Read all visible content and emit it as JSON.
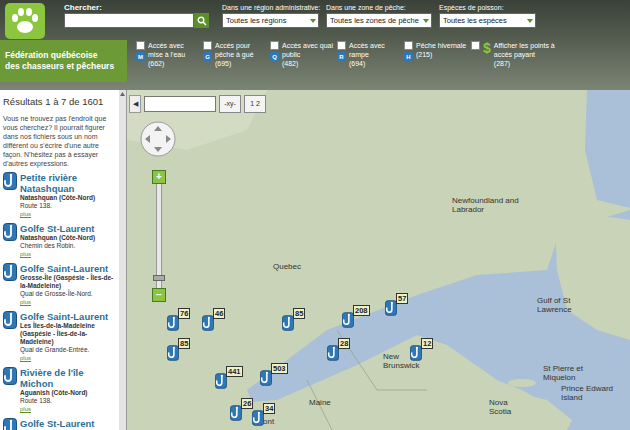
{
  "logo": {
    "title_lines": [
      "Fédération québécoise",
      "des chasseurs et pêcheurs"
    ]
  },
  "search": {
    "label": "Chercher:",
    "value": ""
  },
  "filters": [
    {
      "label": "Dans une région administrative:",
      "value": "Toutes les régions"
    },
    {
      "label": "Dans une zone de pêche:",
      "value": "Toutes les zones de pêche"
    },
    {
      "label": "Espèces de poisson:",
      "value": "Toutes les espèces"
    }
  ],
  "access_filters": [
    {
      "badge": "M",
      "label": "Accès avec mise à l'eau",
      "count": "(662)",
      "checked": false
    },
    {
      "badge": "G",
      "label": "Accès pour pêche à gué",
      "count": "(695)",
      "checked": false
    },
    {
      "badge": "Q",
      "label": "Accès avec quai public",
      "count": "(482)",
      "checked": false
    },
    {
      "badge": "R",
      "label": "Accès avec rampe",
      "count": "(694)",
      "checked": false
    },
    {
      "badge": "H",
      "label": "Pêche hivernale",
      "count": "(215)",
      "checked": false
    }
  ],
  "paid_filter": {
    "badge": "$",
    "label": "Afficher les points à accès payant",
    "count": "(287)",
    "checked": false
  },
  "results": {
    "summary": "Résultats 1 à 7 de 1601",
    "hint": "Vous ne trouvez pas l'endroit que vous cherchez? Il pourrait figurer dans nos fichiers sous un nom différent ou s'écrire d'une autre façon. N'hésitez pas à essayer d'autres expressions.",
    "items": [
      {
        "title": "Petite rivière Natashquan",
        "location": "Natashquan (Côte-Nord)",
        "road": "Route 138.",
        "link": "plus"
      },
      {
        "title": "Golfe St-Laurent",
        "location": "Natashquan (Côte-Nord)",
        "road": "Chemin des Robin.",
        "link": "plus"
      },
      {
        "title": "Golfe Saint-Laurent",
        "location": "Grosse-Île (Gaspésie - Îles-de-la-Madeleine)",
        "road": "Quai de Grosse-Île-Nord.",
        "link": "plus"
      },
      {
        "title": "Golfe Saint-Laurent",
        "location": "Les Îles-de-la-Madeleine (Gaspésie - Îles-de-la-Madeleine)",
        "road": "Quai de Grande-Entrée.",
        "link": "plus"
      },
      {
        "title": "Rivière de l'île Michon",
        "location": "Aguanish (Côte-Nord)",
        "road": "Route 138.",
        "link": "plus"
      },
      {
        "title": "Golfe St-Laurent",
        "location": "",
        "road": "",
        "link": ""
      }
    ]
  },
  "map": {
    "collapse": "◀",
    "coords_value": "",
    "buttons": [
      "-xy-",
      "1 2"
    ],
    "zoom": {
      "plus": "+",
      "minus": "−",
      "level": 0.05
    },
    "labels": [
      "Quebec",
      "Newfoundland and Labrador",
      "Gulf of St Lawrence",
      "New Brunswick",
      "St Pierre et Miquelon",
      "Prince Edward Island",
      "Nova Scotia",
      "Maine",
      "ont"
    ],
    "pins": [
      "76",
      "46",
      "85",
      "208",
      "57",
      "85",
      "28",
      "12",
      "441",
      "503",
      "26",
      "34"
    ]
  }
}
